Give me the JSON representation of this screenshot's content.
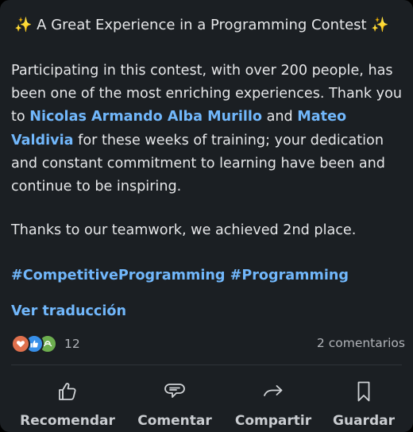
{
  "post": {
    "title_spark_left": "✨",
    "title": "A Great Experience in a Programming Contest",
    "title_spark_right": "✨",
    "paragraph1": {
      "text_before": "Participating in this contest, with over 200 people, has been one of the most enriching experiences. Thank you to ",
      "mention1": "Nicolas Armando Alba Murillo",
      "text_and": " and ",
      "mention2": "Mateo Valdivia",
      "text_after": " for these weeks of training; your dedication and constant commitment to learning have been and continue to be inspiring."
    },
    "paragraph2": "Thanks to our teamwork, we achieved 2nd place.",
    "hashtags": "#CompetitiveProgramming #Programming",
    "translate_link": "Ver traducción"
  },
  "social": {
    "reaction_icons": [
      "love-icon",
      "like-icon",
      "support-icon"
    ],
    "reaction_count": "12",
    "comments": "2 comentarios"
  },
  "actions": [
    {
      "label": "Recomendar",
      "icon": "thumbs-up-icon"
    },
    {
      "label": "Comentar",
      "icon": "comment-icon"
    },
    {
      "label": "Compartir",
      "icon": "share-arrow-icon"
    },
    {
      "label": "Guardar",
      "icon": "bookmark-icon"
    }
  ],
  "colors": {
    "card_background": "#1b1f23",
    "text": "#e6e7e9",
    "link": "#71b7fb",
    "muted": "#b0b3b8",
    "love": "#df704d",
    "like": "#378fe9",
    "support": "#6dae4f"
  }
}
